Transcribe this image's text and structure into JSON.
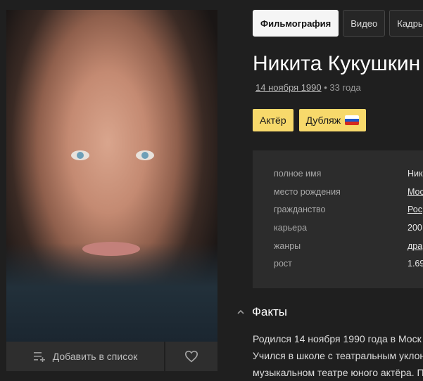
{
  "tabs": [
    {
      "label": "Фильмография",
      "active": true
    },
    {
      "label": "Видео",
      "active": false
    },
    {
      "label": "Кадры",
      "active": false
    }
  ],
  "person": {
    "name": "Никита Кукушкин",
    "birth_date": "14 ноября 1990",
    "age": "• 33 года"
  },
  "roles": [
    {
      "label": "Актёр"
    },
    {
      "label": "Дубляж",
      "flag": "russia-flag"
    }
  ],
  "info": [
    {
      "label": "полное имя",
      "value": "Ник"
    },
    {
      "label": "место рождения",
      "value": "Мос"
    },
    {
      "label": "гражданство",
      "value": "Рос"
    },
    {
      "label": "карьера",
      "value": "200"
    },
    {
      "label": "жанры",
      "value": "дра"
    },
    {
      "label": "рост",
      "value": "1.69"
    }
  ],
  "photo_actions": {
    "add_label": "Добавить в список",
    "add_icon": "add-to-list-icon",
    "fav_icon": "heart-icon"
  },
  "facts": {
    "title": "Факты",
    "lines": [
      "Родился 14 ноября 1990 года в Моск",
      "Учился в школе с театральным уклон",
      "музыкальном театре юного актёра. П"
    ]
  },
  "colors": {
    "background": "#1f1f1f",
    "accent": "#f7d96b",
    "panel": "#2c2c2c"
  }
}
